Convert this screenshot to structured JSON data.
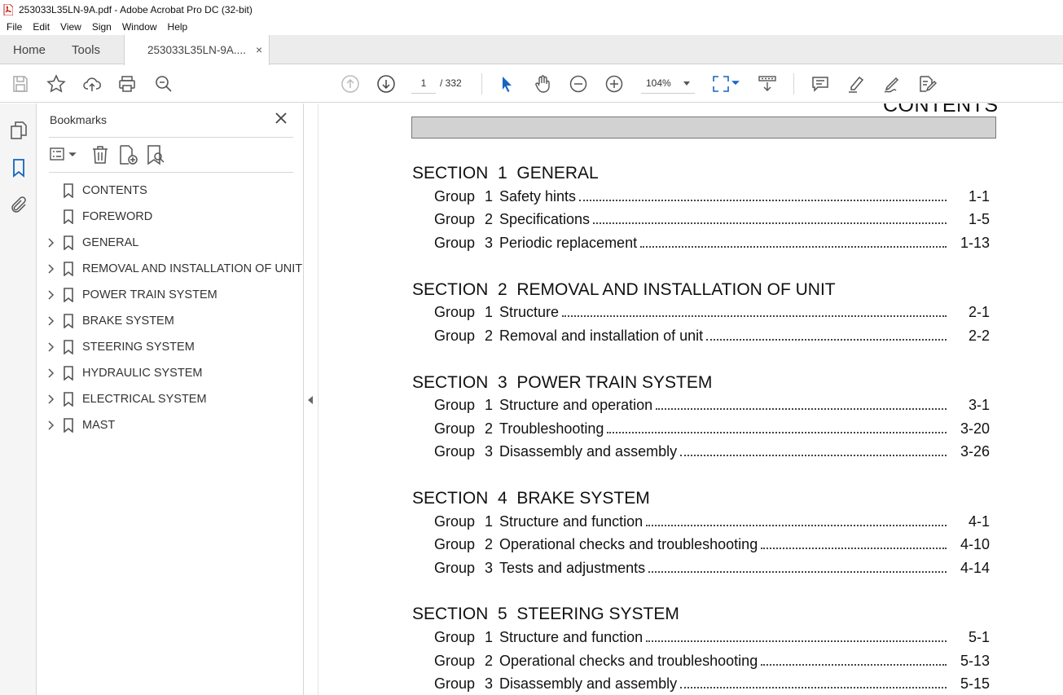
{
  "window": {
    "title": "253033L35LN-9A.pdf - Adobe Acrobat Pro DC (32-bit)"
  },
  "menu": [
    "File",
    "Edit",
    "View",
    "Sign",
    "Window",
    "Help"
  ],
  "tabs": {
    "home": "Home",
    "tools": "Tools",
    "document": "253033L35LN-9A....",
    "close": "×"
  },
  "toolbar": {
    "page_current": "1",
    "page_total": "/ 332",
    "zoom": "104%"
  },
  "bookmarks": {
    "title": "Bookmarks",
    "items": [
      {
        "label": "CONTENTS",
        "expandable": false
      },
      {
        "label": "FOREWORD",
        "expandable": false
      },
      {
        "label": "GENERAL",
        "expandable": true
      },
      {
        "label": "REMOVAL AND INSTALLATION OF UNIT",
        "expandable": true
      },
      {
        "label": "POWER TRAIN SYSTEM",
        "expandable": true
      },
      {
        "label": "BRAKE SYSTEM",
        "expandable": true
      },
      {
        "label": "STEERING SYSTEM",
        "expandable": true
      },
      {
        "label": "HYDRAULIC SYSTEM",
        "expandable": true
      },
      {
        "label": "ELECTRICAL SYSTEM",
        "expandable": true
      },
      {
        "label": "MAST",
        "expandable": true
      }
    ]
  },
  "document": {
    "heading": "CONTENTS",
    "sections": [
      {
        "title": "SECTION  1  GENERAL",
        "groups": [
          {
            "word": "Group",
            "num": "1",
            "title": "Safety hints",
            "page": "1-1"
          },
          {
            "word": "Group",
            "num": "2",
            "title": "Specifications",
            "page": "1-5"
          },
          {
            "word": "Group",
            "num": "3",
            "title": "Periodic replacement",
            "page": "1-13"
          }
        ]
      },
      {
        "title": "SECTION  2  REMOVAL AND INSTALLATION OF UNIT",
        "groups": [
          {
            "word": "Group",
            "num": "1",
            "title": "Structure",
            "page": "2-1"
          },
          {
            "word": "Group",
            "num": "2",
            "title": "Removal and installation of unit",
            "page": "2-2"
          }
        ]
      },
      {
        "title": "SECTION  3  POWER TRAIN SYSTEM",
        "groups": [
          {
            "word": "Group",
            "num": "1",
            "title": "Structure and operation",
            "page": "3-1"
          },
          {
            "word": "Group",
            "num": "2",
            "title": "Troubleshooting",
            "page": "3-20"
          },
          {
            "word": "Group",
            "num": "3",
            "title": "Disassembly and assembly",
            "page": "3-26"
          }
        ]
      },
      {
        "title": "SECTION  4  BRAKE SYSTEM",
        "groups": [
          {
            "word": "Group",
            "num": "1",
            "title": "Structure and function",
            "page": "4-1"
          },
          {
            "word": "Group",
            "num": "2",
            "title": "Operational checks and troubleshooting",
            "page": "4-10"
          },
          {
            "word": "Group",
            "num": "3",
            "title": "Tests and adjustments",
            "page": "4-14"
          }
        ]
      },
      {
        "title": "SECTION  5  STEERING SYSTEM",
        "groups": [
          {
            "word": "Group",
            "num": "1",
            "title": "Structure and function",
            "page": "5-1"
          },
          {
            "word": "Group",
            "num": "2",
            "title": "Operational checks and troubleshooting",
            "page": "5-13"
          },
          {
            "word": "Group",
            "num": "3",
            "title": "Disassembly and assembly",
            "page": "5-15"
          }
        ]
      }
    ]
  }
}
